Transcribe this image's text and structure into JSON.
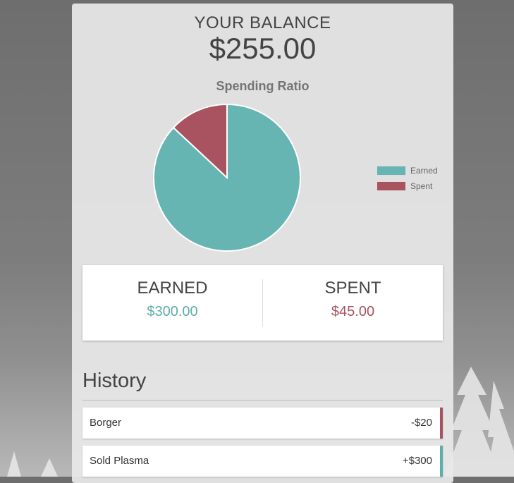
{
  "balance": {
    "title": "YOUR BALANCE",
    "value": "$255.00"
  },
  "chart_data": {
    "type": "pie",
    "title": "Spending Ratio",
    "labels": [
      "Earned",
      "Spent"
    ],
    "values": [
      300,
      45
    ],
    "colors": [
      "#66b5b3",
      "#a8535f"
    ],
    "legend": "right"
  },
  "stats": {
    "earned": {
      "label": "EARNED",
      "value": "$300.00"
    },
    "spent": {
      "label": "SPENT",
      "value": "$45.00"
    }
  },
  "history": {
    "title": "History",
    "items": [
      {
        "name": "Borger",
        "amount": "-$20",
        "type": "spent"
      },
      {
        "name": "Sold Plasma",
        "amount": "+$300",
        "type": "earned"
      }
    ]
  },
  "colors": {
    "earned": "#5aaeac",
    "spent": "#a8535f",
    "text": "#444444"
  }
}
